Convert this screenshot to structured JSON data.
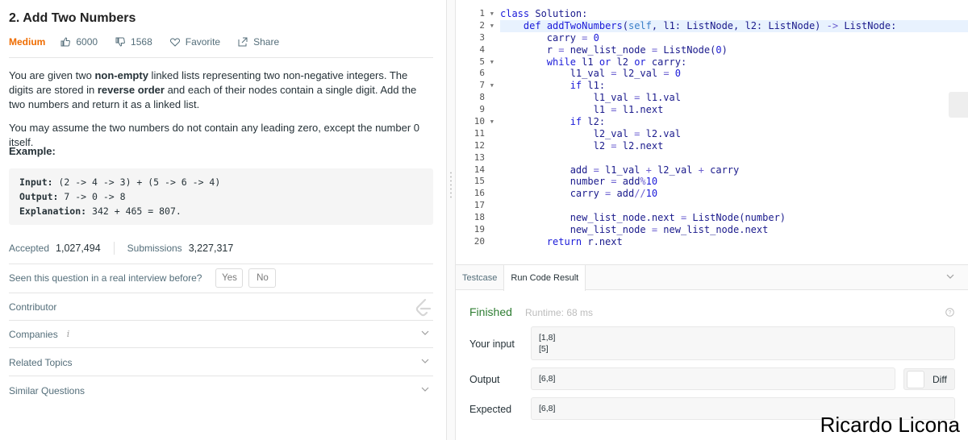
{
  "problem": {
    "title": "2. Add Two Numbers",
    "difficulty": "Medium",
    "likes": "6000",
    "dislikes": "1568",
    "favorite_label": "Favorite",
    "share_label": "Share",
    "description_parts": [
      "You are given two ",
      "non-empty",
      " linked lists representing two non-negative integers. The digits are stored in ",
      "reverse order",
      " and each of their nodes contain a single digit. Add the two numbers and return it as a linked list."
    ],
    "assumption": "You may assume the two numbers do not contain any leading zero, except the number 0 itself.",
    "example_label": "Example:",
    "example": {
      "input_label": "Input:",
      "input_value": "(2 -> 4 -> 3) + (5 -> 6 -> 4)",
      "output_label": "Output:",
      "output_value": "7 -> 0 -> 8",
      "explanation_label": "Explanation:",
      "explanation_value": "342 + 465 = 807."
    },
    "accepted_label": "Accepted",
    "accepted_value": "1,027,494",
    "submissions_label": "Submissions",
    "submissions_value": "3,227,317",
    "seen_question": "Seen this question in a real interview before?",
    "yes_label": "Yes",
    "no_label": "No",
    "sections": {
      "contributor": "Contributor",
      "companies": "Companies",
      "companies_info": "i",
      "related": "Related Topics",
      "similar": "Similar Questions"
    }
  },
  "editor": {
    "line_numbers": [
      "1",
      "2",
      "3",
      "4",
      "5",
      "6",
      "7",
      "8",
      "9",
      "10",
      "11",
      "12",
      "13",
      "14",
      "15",
      "16",
      "17",
      "18",
      "19",
      "20"
    ],
    "folded_lines": [
      1,
      2,
      5,
      7,
      10
    ],
    "active_line": 2
  },
  "result": {
    "tabs": [
      "Testcase",
      "Run Code Result"
    ],
    "active_tab": 1,
    "status": "Finished",
    "runtime": "Runtime: 68 ms",
    "input_label": "Your input",
    "input_lines": [
      "[1,8]",
      "[5]"
    ],
    "output_label": "Output",
    "output_value": "[6,8]",
    "diff_label": "Diff",
    "expected_label": "Expected",
    "expected_value": "[6,8]"
  },
  "watermark": "Ricardo Licona",
  "colors": {
    "difficulty": "#ef6c00",
    "finished": "#2e7d32",
    "keyword": "#1a1ad9",
    "active_line_bg": "#e8f2fe"
  }
}
